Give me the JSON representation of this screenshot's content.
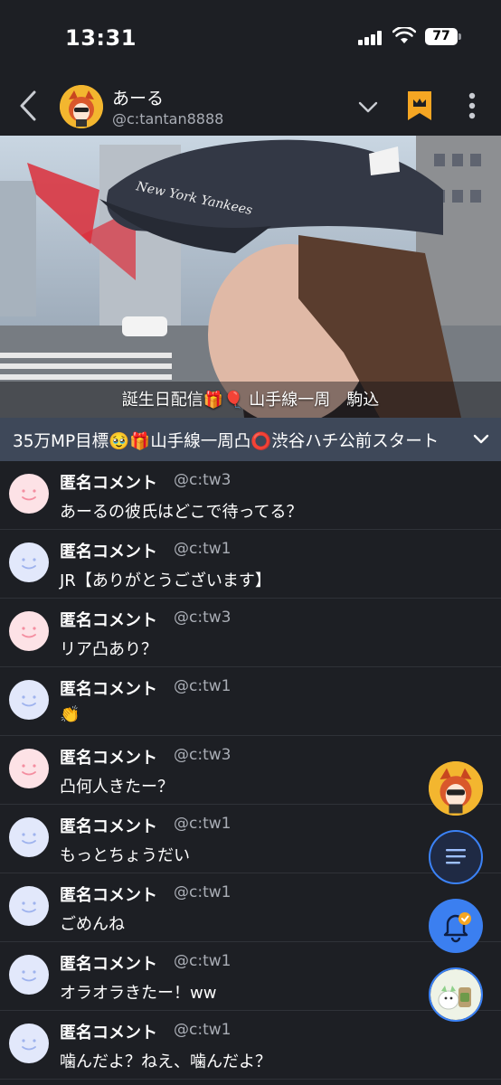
{
  "status_bar": {
    "time": "13:31",
    "battery": "77"
  },
  "header": {
    "host_name": "あーる",
    "host_id": "@c:tantan8888"
  },
  "video": {
    "caption": "誕生日配信🎁🎈 山手線一周　駒込"
  },
  "ticker": {
    "text": "35万MP目標🥹🎁山手線一周凸⭕渋谷ハチ公前スタート"
  },
  "comments": [
    {
      "avatar": "pink",
      "name": "匿名コメント",
      "id": "@c:tw3",
      "text": "あーるの彼氏はどこで待ってる？"
    },
    {
      "avatar": "blue",
      "name": "匿名コメント",
      "id": "@c:tw1",
      "text": "JR【ありがとうございます】"
    },
    {
      "avatar": "pink",
      "name": "匿名コメント",
      "id": "@c:tw3",
      "text": "リア凸あり？"
    },
    {
      "avatar": "blue",
      "name": "匿名コメント",
      "id": "@c:tw1",
      "text": "👏"
    },
    {
      "avatar": "pink",
      "name": "匿名コメント",
      "id": "@c:tw3",
      "text": "凸何人きたー？"
    },
    {
      "avatar": "blue",
      "name": "匿名コメント",
      "id": "@c:tw1",
      "text": "もっとちょうだい"
    },
    {
      "avatar": "blue",
      "name": "匿名コメント",
      "id": "@c:tw1",
      "text": "ごめんね"
    },
    {
      "avatar": "blue",
      "name": "匿名コメント",
      "id": "@c:tw1",
      "text": "オラオラきたー！ww"
    },
    {
      "avatar": "blue",
      "name": "匿名コメント",
      "id": "@c:tw1",
      "text": "噛んだよ？ねえ、噛んだよ？"
    }
  ],
  "colors": {
    "accent_orange": "#f5a623",
    "accent_blue": "#3b82f6",
    "background": "#1d1f24",
    "ticker_bg": "#3e4859"
  },
  "icons": [
    "back-icon",
    "chevron-down-icon",
    "bookmark-crown-icon",
    "more-vertical-icon",
    "list-icon",
    "bell-icon",
    "check-badge-icon"
  ]
}
